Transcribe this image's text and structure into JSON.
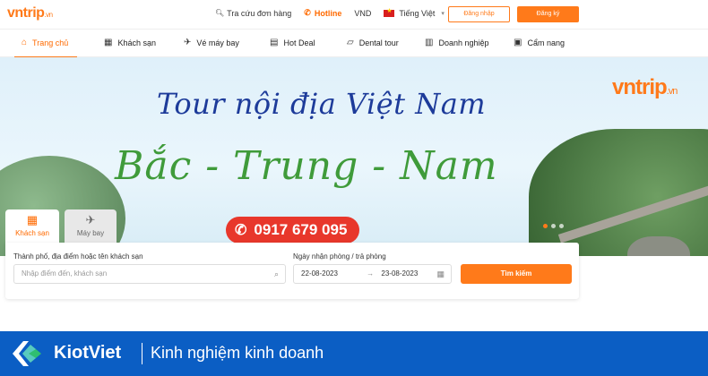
{
  "header": {
    "logo": "vntrip",
    "logo_suffix": ".vn",
    "lookup_link": "Tra cứu đơn hàng",
    "hotline_label": "Hotline",
    "currency": "VND",
    "language": "Tiếng Việt",
    "login_label": "Đăng nhập",
    "register_label": "Đăng ký"
  },
  "nav": {
    "items": [
      {
        "label": "Trang chủ",
        "icon": "home-icon"
      },
      {
        "label": "Khách sạn",
        "icon": "building-icon"
      },
      {
        "label": "Vé máy bay",
        "icon": "plane-icon"
      },
      {
        "label": "Hot Deal",
        "icon": "deal-icon"
      },
      {
        "label": "Dental tour",
        "icon": "tooth-icon"
      },
      {
        "label": "Doanh nghiệp",
        "icon": "business-icon"
      },
      {
        "label": "Cẩm nang",
        "icon": "book-icon"
      }
    ],
    "active_index": 0
  },
  "banner": {
    "headline": "Tour nội địa Việt Nam",
    "subheadline": "Bắc - Trung - Nam",
    "phone": "0917 679 095",
    "logo": "vntrip",
    "logo_suffix": ".vn"
  },
  "search": {
    "tabs": [
      {
        "label": "Khách sạn",
        "active": true
      },
      {
        "label": "Máy bay",
        "active": false
      }
    ],
    "destination_label": "Thành phố, địa điểm hoặc tên khách sạn",
    "destination_placeholder": "Nhập điểm đến, khách sạn",
    "dates_label": "Ngày nhận phòng / trả phòng",
    "checkin": "22-08-2023",
    "date_arrow": "→",
    "checkout": "23-08-2023",
    "submit_label": "Tìm kiếm"
  },
  "footer": {
    "brand": "KiotViet",
    "tagline": "Kinh nghiệm kinh doanh",
    "colors": {
      "background": "#0b5ec4",
      "accent": "#ff7a1a"
    }
  }
}
